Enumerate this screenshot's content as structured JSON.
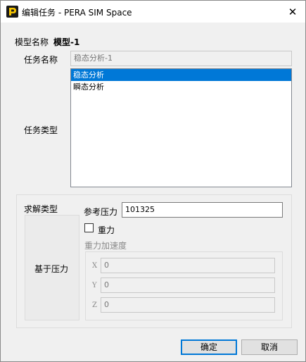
{
  "window": {
    "title": "编辑任务 - PERA SIM Space",
    "close_glyph": "✕"
  },
  "model": {
    "label": "模型名称",
    "value": "模型-1"
  },
  "task_name": {
    "label": "任务名称",
    "value": "稳态分析-1"
  },
  "task_type": {
    "label": "任务类型",
    "items": [
      "稳态分析",
      "瞬态分析"
    ],
    "selected_index": 0
  },
  "solver": {
    "group_label": "求解类型",
    "mode_label": "基于压力",
    "ref_pressure_label": "参考压力",
    "ref_pressure_value": "101325",
    "gravity_label": "重力",
    "gravity_checked": false,
    "gravity_accel_label": "重力加速度",
    "x_label": "X",
    "x_value": "0",
    "y_label": "Y",
    "y_value": "0",
    "z_label": "Z",
    "z_value": "0"
  },
  "buttons": {
    "ok": "确定",
    "cancel": "取消"
  },
  "colors": {
    "selection": "#0078d7",
    "icon_bg": "#1a1a1a",
    "icon_accent": "#f5c400"
  }
}
